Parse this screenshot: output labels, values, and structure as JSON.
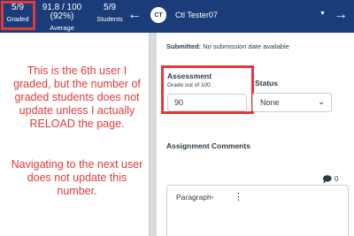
{
  "header": {
    "graded": {
      "value": "5/9",
      "label": "Graded"
    },
    "average": {
      "value": "91.8 / 100 (92%)",
      "label": "Average"
    },
    "students": {
      "value": "5/9",
      "label": "Students"
    },
    "avatar_initials": "CT",
    "user_name": "Ctl Tester07",
    "background_color": "#1a3c78"
  },
  "annotation": {
    "paragraph_1": "This is the 6th user I graded, but the number of graded students does not update unless I actually RELOAD the page.",
    "paragraph_2": "Navigating to the next user does not update this number.",
    "color": "#e23a3a"
  },
  "submission": {
    "label": "Submitted:",
    "text": "No submission date available"
  },
  "assessment": {
    "title": "Assessment",
    "subtitle": "Grade out of 100",
    "grade_value": "90"
  },
  "status": {
    "label": "Status",
    "value": "None"
  },
  "comments": {
    "title": "Assignment Comments",
    "count": "0",
    "editor_format": "Paragraph"
  },
  "icons": [
    "arrow-left-icon",
    "arrow-right-icon",
    "caret-down-icon",
    "chevron-down-icon",
    "comment-icon",
    "kebab-icon"
  ]
}
